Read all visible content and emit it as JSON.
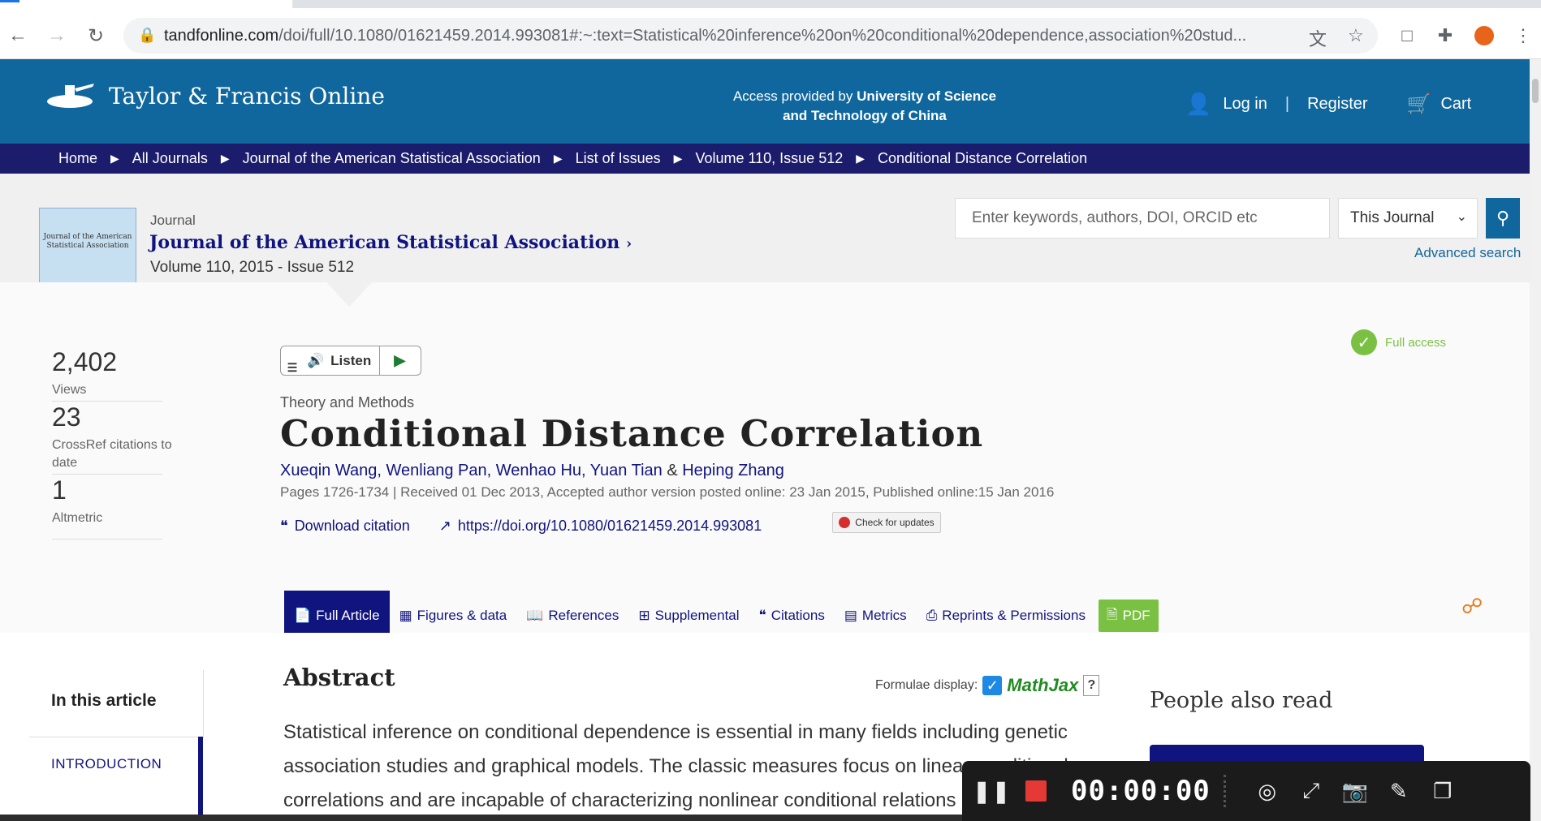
{
  "browser": {
    "url_host": "tandfonline.com",
    "url_path": "/doi/full/10.1080/01621459.2014.993081#:~:text=Statistical%20inference%20on%20conditional%20dependence,association%20stud..."
  },
  "header": {
    "logo_text": "Taylor & Francis Online",
    "access_prefix": "Access provided by ",
    "access_inst_line1": "University of Science",
    "access_inst_line2": "and Technology of China",
    "login": "Log in",
    "register": "Register",
    "cart": "Cart"
  },
  "breadcrumb": [
    "Home",
    "All Journals",
    "Journal of the American Statistical Association",
    "List of Issues",
    "Volume 110, Issue 512",
    "Conditional Distance Correlation"
  ],
  "journal": {
    "label": "Journal",
    "title": "Journal of the American Statistical Association",
    "volume": "Volume 110, 2015 - Issue 512",
    "cover_text": "Journal of the American Statistical Association"
  },
  "search": {
    "placeholder": "Enter keywords, authors, DOI, ORCID etc",
    "scope": "This Journal",
    "advanced": "Advanced search"
  },
  "metrics": [
    {
      "value": "2,402",
      "label": "Views"
    },
    {
      "value": "23",
      "label": "CrossRef citations to date"
    },
    {
      "value": "1",
      "label": "Altmetric"
    }
  ],
  "listen_label": "Listen",
  "full_access": "Full access",
  "article": {
    "type": "Theory and Methods",
    "title": "Conditional Distance Correlation",
    "authors": [
      "Xueqin Wang",
      "Wenliang Pan",
      "Wenhao Hu",
      "Yuan Tian",
      "Heping Zhang"
    ],
    "pubinfo": "Pages 1726-1734 | Received 01 Dec 2013, Accepted author version posted online: 23 Jan 2015, Published online:15 Jan 2016",
    "download_citation": "Download citation",
    "doi": "https://doi.org/10.1080/01621459.2014.993081",
    "check_updates": "Check for updates"
  },
  "tabs": [
    "Full Article",
    "Figures & data",
    "References",
    "Supplemental",
    "Citations",
    "Metrics",
    "Reprints & Permissions",
    "PDF"
  ],
  "toc": {
    "heading": "In this article",
    "item": "INTRODUCTION"
  },
  "abstract": {
    "heading": "Abstract",
    "formulae_label": "Formulae display:",
    "mathjax": "MathJax",
    "help": "?",
    "text": "Statistical inference on conditional dependence is essential in many fields including genetic association studies and graphical models. The classic measures focus on linear conditional correlations and are incapable of characterizing nonlinear conditional relations"
  },
  "people_also_read": "People also read",
  "recorder": {
    "time": "00:00:00"
  }
}
